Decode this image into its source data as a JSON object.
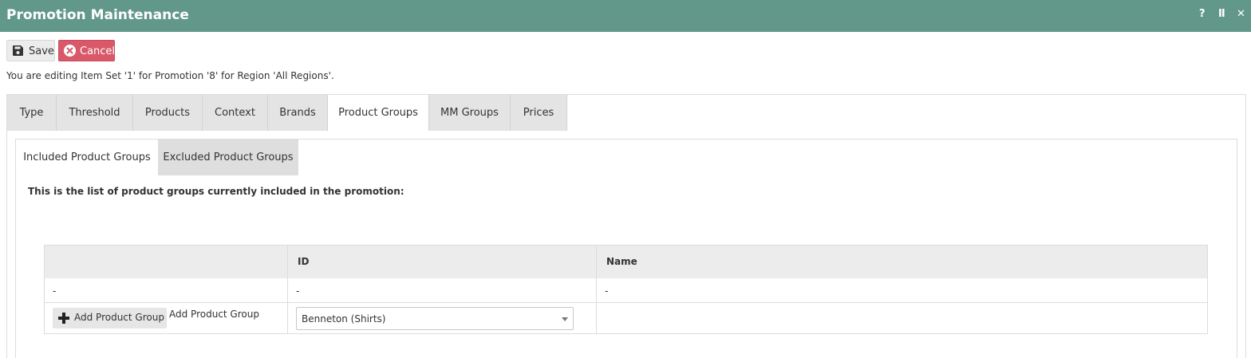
{
  "window": {
    "title": "Promotion Maintenance",
    "controls": {
      "help": "?",
      "pause": "II",
      "close": "✕"
    }
  },
  "toolbar": {
    "save_label": "Save",
    "cancel_label": "Cancel",
    "save_icon": "floppy-disk-icon",
    "cancel_icon": "close-circle-icon"
  },
  "info_text": "You are editing Item Set '1' for Promotion '8' for Region 'All Regions'.",
  "tabs": [
    {
      "label": "Type"
    },
    {
      "label": "Threshold"
    },
    {
      "label": "Products"
    },
    {
      "label": "Context"
    },
    {
      "label": "Brands"
    },
    {
      "label": "Product Groups",
      "active": true
    },
    {
      "label": "MM Groups"
    },
    {
      "label": "Prices"
    }
  ],
  "subtabs": [
    {
      "label": "Included Product Groups",
      "active": true
    },
    {
      "label": "Excluded Product Groups"
    }
  ],
  "description": "This is the list of product groups currently included in the promotion:",
  "table": {
    "headers": [
      "",
      "ID",
      "Name"
    ],
    "rows": [
      {
        "col1": "-",
        "id": "-",
        "name": "-"
      }
    ],
    "add_row": {
      "button_label": "Add Product Group",
      "button_icon": "plus-icon",
      "label": "Add Product Group",
      "select_value": "Benneton (Shirts)"
    }
  },
  "colors": {
    "titlebar": "#62988a",
    "cancel": "#d9596a",
    "tab_inactive": "#e4e4e4",
    "header_bg": "#ececec"
  }
}
